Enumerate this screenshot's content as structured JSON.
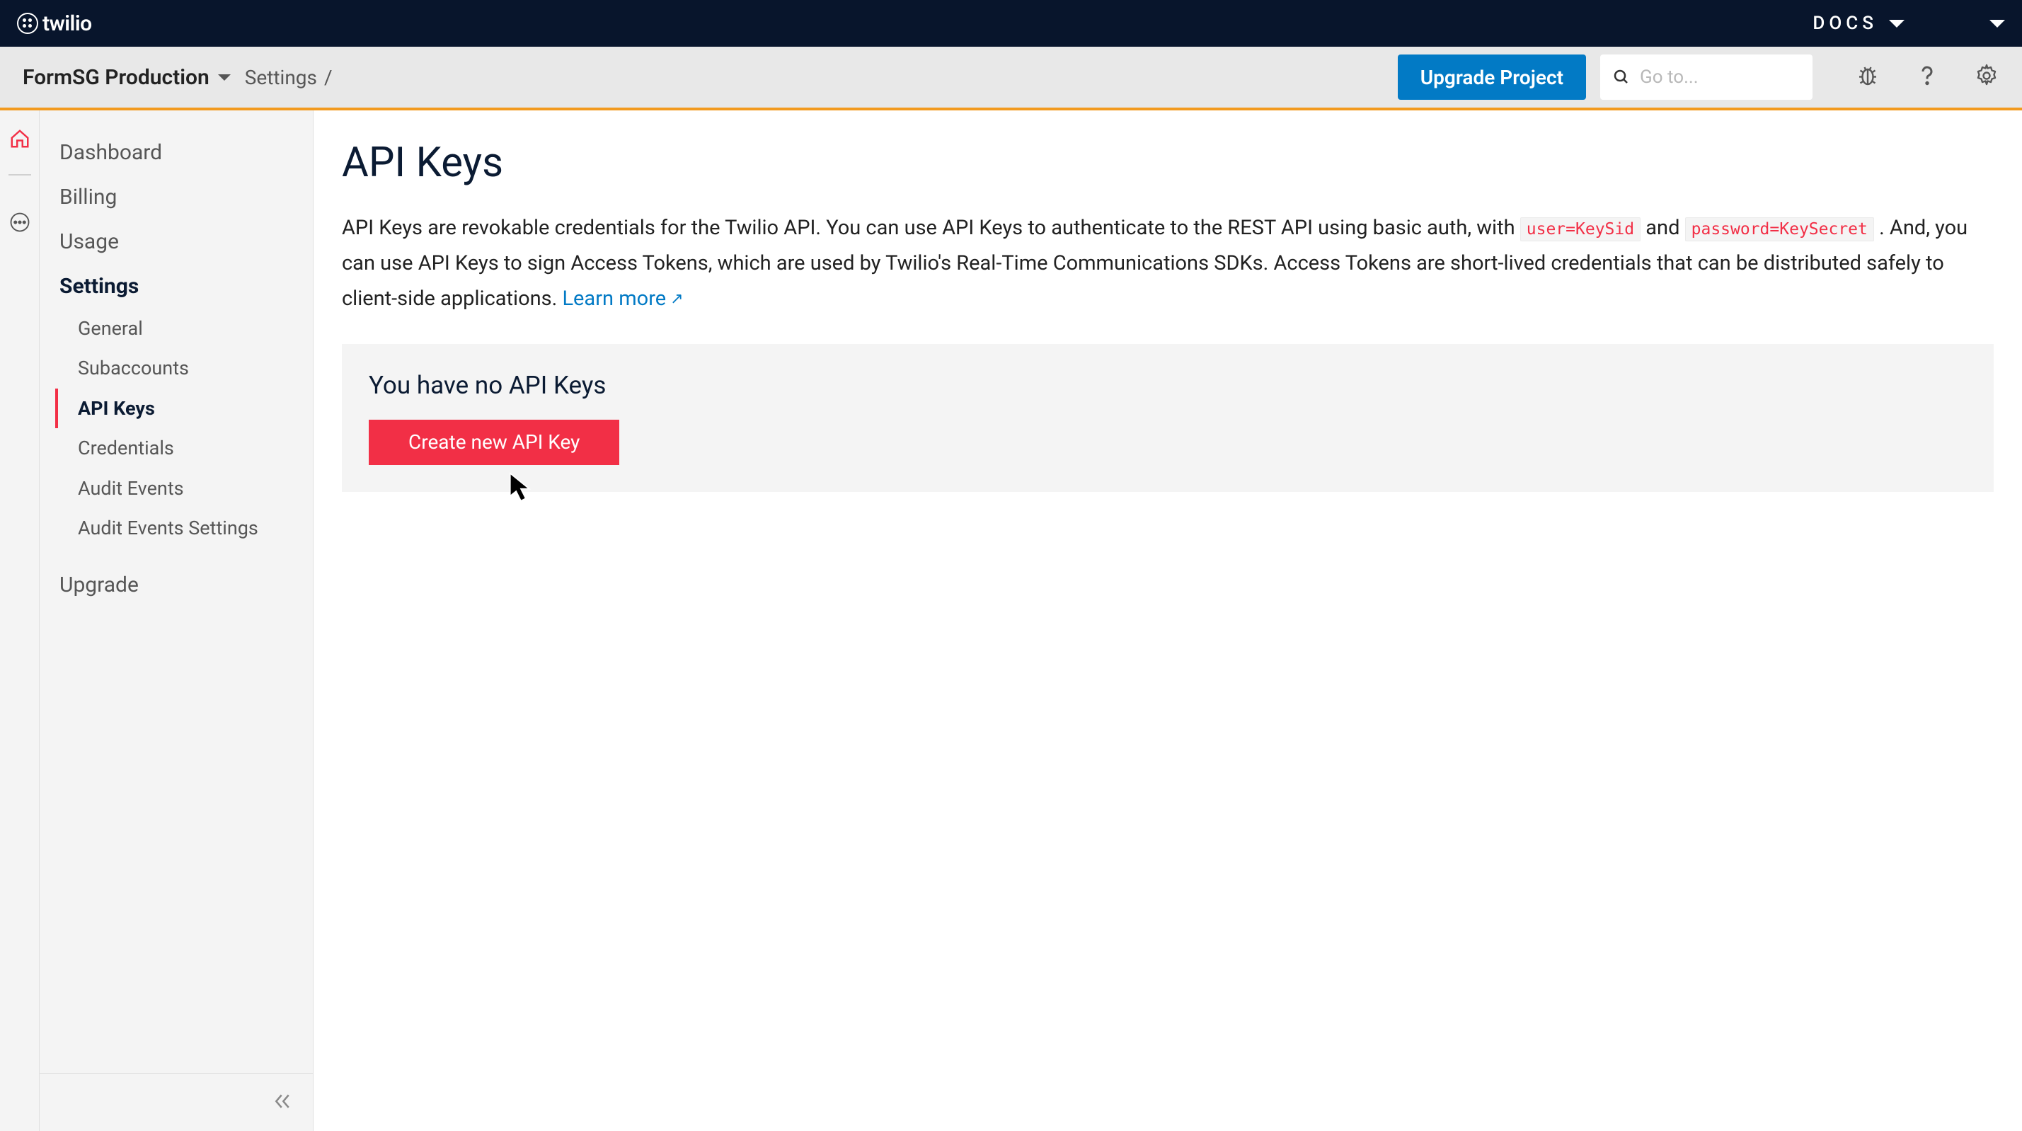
{
  "topnav": {
    "brand": "twilio",
    "docs_label": "DOCS"
  },
  "secondbar": {
    "project_name": "FormSG Production",
    "breadcrumb_item": "Settings",
    "breadcrumb_sep": "/",
    "upgrade_label": "Upgrade Project",
    "search_placeholder": "Go to..."
  },
  "sidebar": {
    "items": [
      {
        "label": "Dashboard"
      },
      {
        "label": "Billing"
      },
      {
        "label": "Usage"
      },
      {
        "label": "Settings",
        "strong": true,
        "subitems": [
          {
            "label": "General"
          },
          {
            "label": "Subaccounts"
          },
          {
            "label": "API Keys",
            "active": true
          },
          {
            "label": "Credentials"
          },
          {
            "label": "Audit Events"
          },
          {
            "label": "Audit Events Settings"
          }
        ]
      },
      {
        "label": "Upgrade"
      }
    ]
  },
  "content": {
    "title": "API Keys",
    "desc_part1": "API Keys are revokable credentials for the Twilio API. You can use API Keys to authenticate to the REST API using basic auth, with ",
    "code1": "user=KeySid",
    "desc_part2": " and ",
    "code2": "password=KeySecret",
    "desc_part3": " . And, you can use API Keys to sign Access Tokens, which are used by Twilio's Real-Time Communications SDKs. Access Tokens are short-lived credentials that can be distributed safely to client-side applications. ",
    "learn_more": "Learn more",
    "empty_title": "You have no API Keys",
    "create_label": "Create new API Key"
  }
}
